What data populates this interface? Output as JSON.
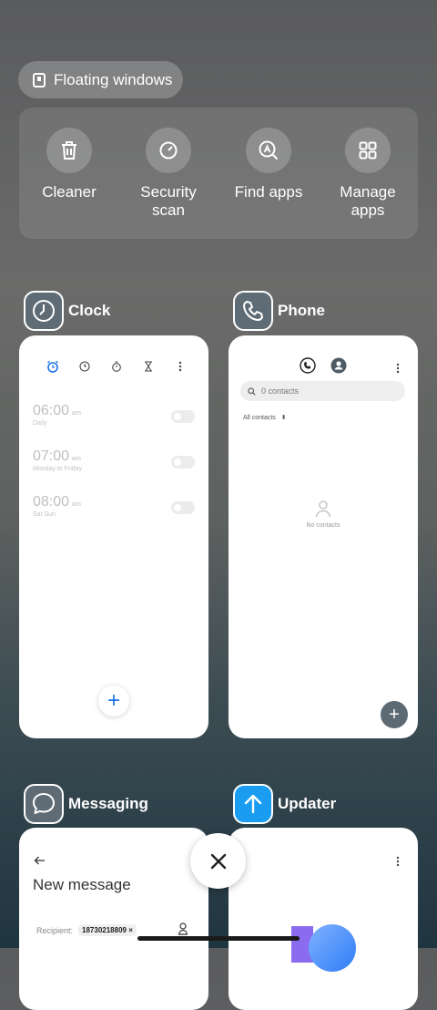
{
  "floating_windows": {
    "label": "Floating windows",
    "icon": "floating-window-icon"
  },
  "tools": [
    {
      "label": "Cleaner",
      "icon": "trash-icon"
    },
    {
      "label": "Security scan",
      "icon": "security-scan-icon"
    },
    {
      "label": "Find apps",
      "icon": "find-apps-icon"
    },
    {
      "label": "Manage apps",
      "icon": "manage-apps-icon"
    }
  ],
  "recent_apps": {
    "clock": {
      "name": "Clock",
      "alarms": [
        {
          "time": "06:00",
          "ampm": "am",
          "days": "Daily"
        },
        {
          "time": "07:00",
          "ampm": "am",
          "days": "Monday to Friday"
        },
        {
          "time": "08:00",
          "ampm": "am",
          "days": "Sat Sun"
        }
      ],
      "fab": "+"
    },
    "phone": {
      "name": "Phone",
      "search_placeholder": "0 contacts",
      "filter": "All contacts",
      "empty": "No contacts",
      "fab": "+"
    },
    "messaging": {
      "name": "Messaging",
      "title": "New message",
      "recipient_label": "Recipient:",
      "recipient_chip": "18730218809 ×"
    },
    "updater": {
      "name": "Updater"
    }
  },
  "colors": {
    "clock_accent": "#1a73e8",
    "updater_icon_bg": "#1a9df0",
    "phone_fab": "#5d6a74"
  }
}
